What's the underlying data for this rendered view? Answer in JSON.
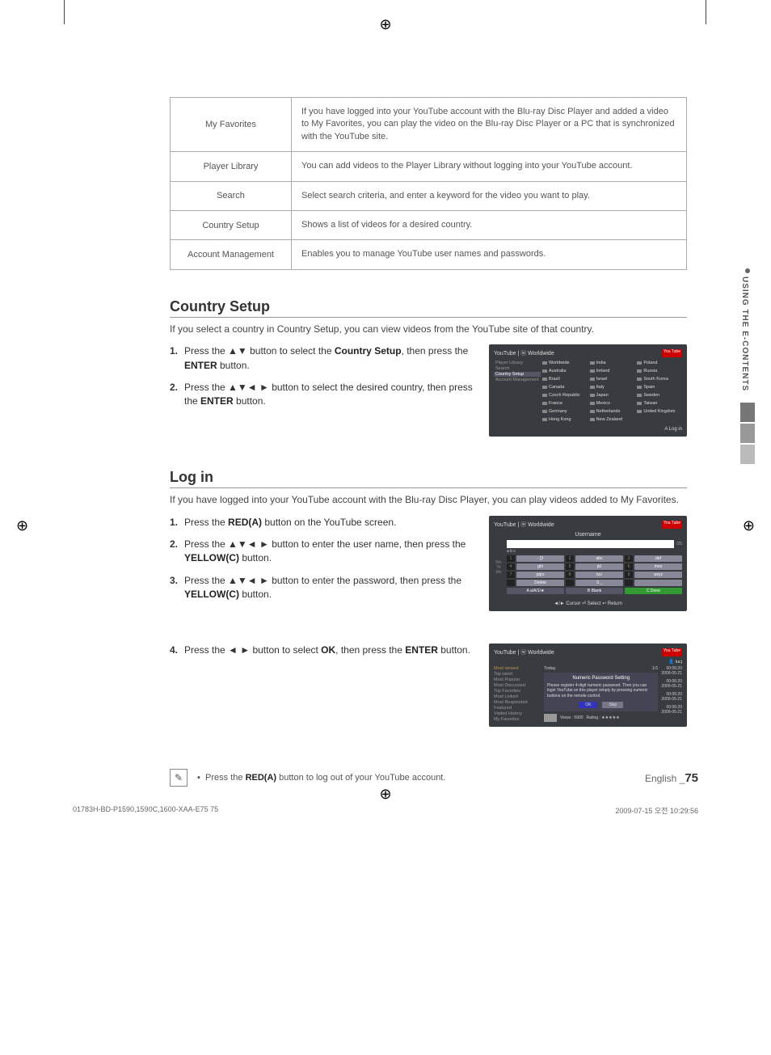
{
  "featureTable": [
    {
      "label": "My Favorites",
      "desc": "If you have logged into your YouTube account with the Blu-ray Disc Player and added a video to My Favorites, you can play the video on the Blu-ray Disc Player or a PC that is synchronized with the YouTube site."
    },
    {
      "label": "Player Library",
      "desc": "You can add videos to the Player Library without logging into your YouTube account."
    },
    {
      "label": "Search",
      "desc": "Select search criteria, and enter a keyword for the video you want to play."
    },
    {
      "label": "Country Setup",
      "desc": "Shows a list of videos for a desired country."
    },
    {
      "label": "Account Management",
      "desc": "Enables you to manage YouTube user names and passwords."
    }
  ],
  "sectionCountry": {
    "title": "Country Setup",
    "intro": "If you select a country in Country Setup, you can view videos from the YouTube site of that country.",
    "steps": [
      {
        "n": "1.",
        "textA": "Press the ▲▼ button to select the ",
        "bold": "Country Setup",
        "textB": ", then press the ",
        "bold2": "ENTER",
        "textC": " button."
      },
      {
        "n": "2.",
        "textA": "Press the ▲▼◄ ► button to select the desired country, then press the ",
        "bold": "ENTER",
        "textB": " button."
      }
    ]
  },
  "countryShot": {
    "header": "YouTube | ⓦ Worldwide",
    "nav": [
      "Player Library",
      "Search",
      "Country Setup",
      "Account Management"
    ],
    "cols": [
      [
        "Worldwide",
        "Australia",
        "Brazil",
        "Canada",
        "Czech Republic",
        "France",
        "Germany",
        "Hong Kong"
      ],
      [
        "India",
        "Ireland",
        "Israel",
        "Italy",
        "Japan",
        "Mexico",
        "Netherlands",
        "New Zealand"
      ],
      [
        "Poland",
        "Russia",
        "South Korea",
        "Spain",
        "Sweden",
        "Taiwan",
        "United Kingdom"
      ]
    ],
    "footer": "A Log in"
  },
  "sectionLogin": {
    "title": "Log in",
    "intro": "If you have logged into your YouTube account with the Blu-ray Disc Player, you can play videos added to My Favorites.",
    "steps": [
      {
        "n": "1.",
        "textA": "Press the ",
        "bold": "RED(A)",
        "textB": " button on the YouTube screen."
      },
      {
        "n": "2.",
        "textA": "Press the ▲▼◄ ► button to enter the user name, then press the ",
        "bold": "YELLOW(C)",
        "textB": " button."
      },
      {
        "n": "3.",
        "textA": "Press the ▲▼◄ ► button to enter the password, then press the ",
        "bold": "YELLOW(C)",
        "textB": " button."
      }
    ],
    "step4": {
      "n": "4.",
      "textA": "Press the ◄ ► button to select ",
      "bold": "OK",
      "textB": ", then press the ",
      "bold2": "ENTER",
      "textC": " button."
    }
  },
  "keypadShot": {
    "header": "YouTube | ⓦ Worldwide",
    "title": "Username",
    "counter": "/25",
    "row0": "a b c",
    "keys": [
      [
        "1",
        "- ()!"
      ],
      [
        "2",
        "abc"
      ],
      [
        "3",
        "def"
      ],
      [
        "4",
        "ghi"
      ],
      [
        "5",
        "jkl"
      ],
      [
        "6",
        "mno"
      ],
      [
        "7",
        "pqrs"
      ],
      [
        "8",
        "tuv"
      ],
      [
        "9",
        "wxyz"
      ]
    ],
    "bottom": [
      [
        "Delete",
        "red"
      ],
      [
        "0  ⎵",
        ""
      ],
      [
        "",
        ""
      ]
    ],
    "bottom2": [
      [
        "A a/A/1/★",
        ""
      ],
      [
        "B Blank",
        ""
      ],
      [
        "C Done",
        "green"
      ]
    ],
    "footer": "◄/► Cursor  ⏎ Select  ↩ Return"
  },
  "modalShot": {
    "header": "YouTube | ⓦ Worldwide",
    "user": "👤 lucj",
    "pager": "1/1",
    "nav": [
      "Most viewed",
      "Top rated",
      "Most Popular",
      "Most Discussed",
      "Top Favorites",
      "Most Linked",
      "Most Responded",
      "Featured",
      "Visited History",
      "My Favorites"
    ],
    "today": "Today",
    "popupTitle": "Numeric Password Setting",
    "popupBody": "Please register 4-digit numeric password. Then you can login YouTube on this player simply by pressing numeric buttons on the remote control.",
    "ok": "OK",
    "skip": "Skip",
    "views": "Views : 5900",
    "rating": "Rating : ★★★★★",
    "times": [
      {
        "t": "00:06:20",
        "d": "2009-05-21"
      },
      {
        "t": "00:06:20",
        "d": "2009-05-21"
      },
      {
        "t": "00:06:20",
        "d": "2009-05-21"
      },
      {
        "t": "00:06:20",
        "d": "2009-05-21"
      }
    ]
  },
  "note": {
    "bullet": "▪",
    "textA": "Press the ",
    "bold": "RED(A)",
    "textB": " button to log out of your YouTube account."
  },
  "sideTab": "USING THE E-CONTENTS",
  "pageFooter": {
    "lang": "English _",
    "num": "75"
  },
  "printFooter": {
    "left": "01783H-BD-P1590,1590C,1600-XAA-E75   75",
    "right": "2009-07-15   오전 10:29:56"
  }
}
